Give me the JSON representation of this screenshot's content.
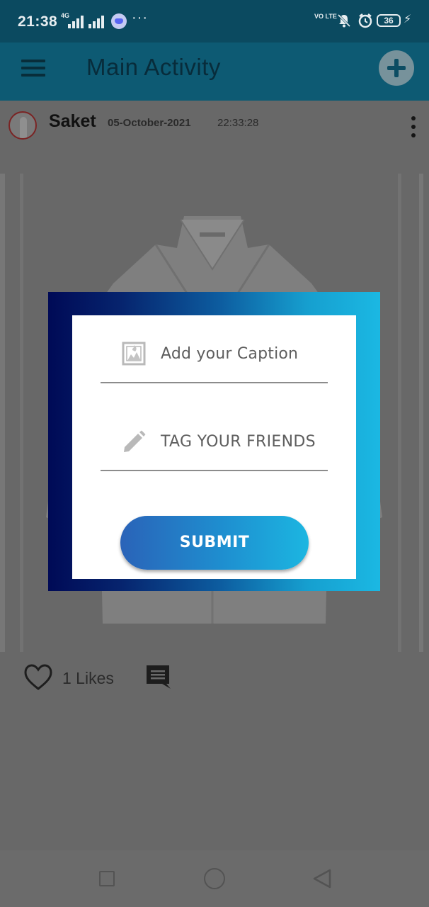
{
  "status_bar": {
    "time": "21:38",
    "network_label": "4G",
    "volte_label": "VO LTE",
    "battery": "36"
  },
  "app_bar": {
    "title": "Main Activity"
  },
  "post": {
    "username": "Saket",
    "date": "05-October-2021",
    "time": "22:33:28",
    "likes": "1 Likes"
  },
  "dialog": {
    "caption_placeholder": "Add your Caption",
    "tags_placeholder": "TAG YOUR FRIENDS",
    "submit_label": "SUBMIT",
    "gradient_start": "#000a56",
    "gradient_end": "#1bb8e3"
  },
  "colors": {
    "app_bar": "#0d5a73",
    "status_bar": "#0b4a60",
    "scrim_background": "#686868",
    "button_gradient_start": "#2a63b8",
    "button_gradient_end": "#1cb6e1"
  },
  "icons": [
    "menu-icon",
    "add-icon",
    "more-vert-icon",
    "heart-icon",
    "comment-icon",
    "image-icon",
    "pencil-icon",
    "nav-square-icon",
    "nav-home-icon",
    "nav-back-icon"
  ]
}
